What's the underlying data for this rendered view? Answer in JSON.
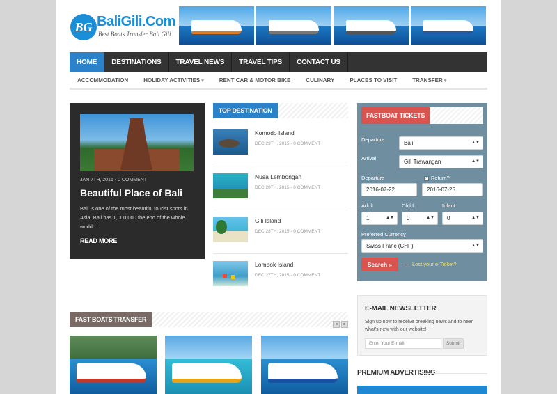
{
  "colors": {
    "accent_blue": "#2b82c9",
    "accent_red": "#d9534f",
    "dark": "#333333",
    "widget_bg": "#6f8ea0",
    "lost_link": "#f2e05d"
  },
  "logo": {
    "badge": "BG",
    "name": "BaliGili.Com",
    "tagline": "Best Boats Transfer Bali Gili"
  },
  "main_nav": [
    "HOME",
    "DESTINATIONS",
    "TRAVEL NEWS",
    "TRAVEL TIPS",
    "CONTACT US"
  ],
  "sub_nav": [
    {
      "label": "ACCOMMODATION",
      "caret": ""
    },
    {
      "label": "HOLIDAY ACTIVITIES",
      "caret": "▾"
    },
    {
      "label": "RENT CAR & MOTOR BIKE",
      "caret": ""
    },
    {
      "label": "CULINARY",
      "caret": ""
    },
    {
      "label": "PLACES TO VISIT",
      "caret": ""
    },
    {
      "label": "TRANSFER",
      "caret": "▾"
    }
  ],
  "featured": {
    "meta": "JAN 7TH, 2016 - 0 COMMENT",
    "title": "Beautiful Place of Bali",
    "excerpt": "Bali is one of the most beautiful tourist spots in Asia. Bali has 1,000,000 the end of the whole world. ...",
    "read_more": "READ MORE"
  },
  "top_destination": {
    "heading": "TOP DESTINATION",
    "items": [
      {
        "name": "Komodo Island",
        "date": "DEC 29TH, 2015 - 0 COMMENT"
      },
      {
        "name": "Nusa Lembongan",
        "date": "DEC 28TH, 2015 - 0 COMMENT"
      },
      {
        "name": "Gili Island",
        "date": "DEC 28TH, 2015 - 0 COMMENT"
      },
      {
        "name": "Lombok Island",
        "date": "DEC 27TH, 2015 - 0 COMMENT"
      }
    ]
  },
  "ticket": {
    "heading": "FASTBOAT TICKETS",
    "departure_label": "Departure",
    "departure_value": "Bali",
    "arrival_label": "Arrival",
    "arrival_value": "Gili Trawangan",
    "date_label": "Departure",
    "date_value": "2016-07-22",
    "return_label": "Return?",
    "return_value": "2016-07-25",
    "adult_label": "Adult",
    "adult_value": "1",
    "child_label": "Child",
    "child_value": "0",
    "infant_label": "Infant",
    "infant_value": "0",
    "currency_label": "Preferred Currency",
    "currency_value": "Swiss Franc (CHF)",
    "search_label": "Search »",
    "lost_label": "Lost your e-Ticket?"
  },
  "newsletter": {
    "heading": "E-MAIL NEWSLETTER",
    "text": "Sign up now to receive breaking news and to hear what's new with our website!",
    "placeholder": "Enter Your E-mail",
    "submit": "Submit"
  },
  "premium": {
    "heading": "PREMIUM ADVERTISING"
  },
  "fast_boats": {
    "heading": "FAST BOATS TRANSFER",
    "prev": "◂",
    "next": "▸"
  }
}
